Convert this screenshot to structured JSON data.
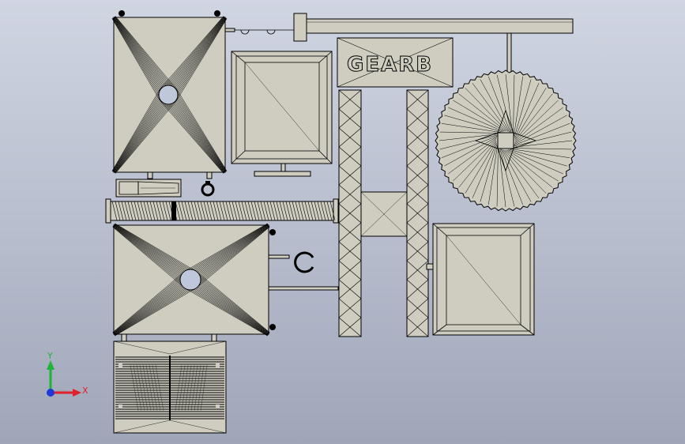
{
  "viewport": {
    "background_top": "#d0d5e2",
    "background_bottom": "#9fa6b8",
    "part_fill": "#cfcdc0",
    "edge_color": "#000000"
  },
  "triad": {
    "x_label": "X",
    "y_label": "Y",
    "x_color": "#e0202a",
    "y_color": "#1fb33a",
    "z_color": "#2038d8"
  },
  "engraving": {
    "text": "GEARB"
  }
}
